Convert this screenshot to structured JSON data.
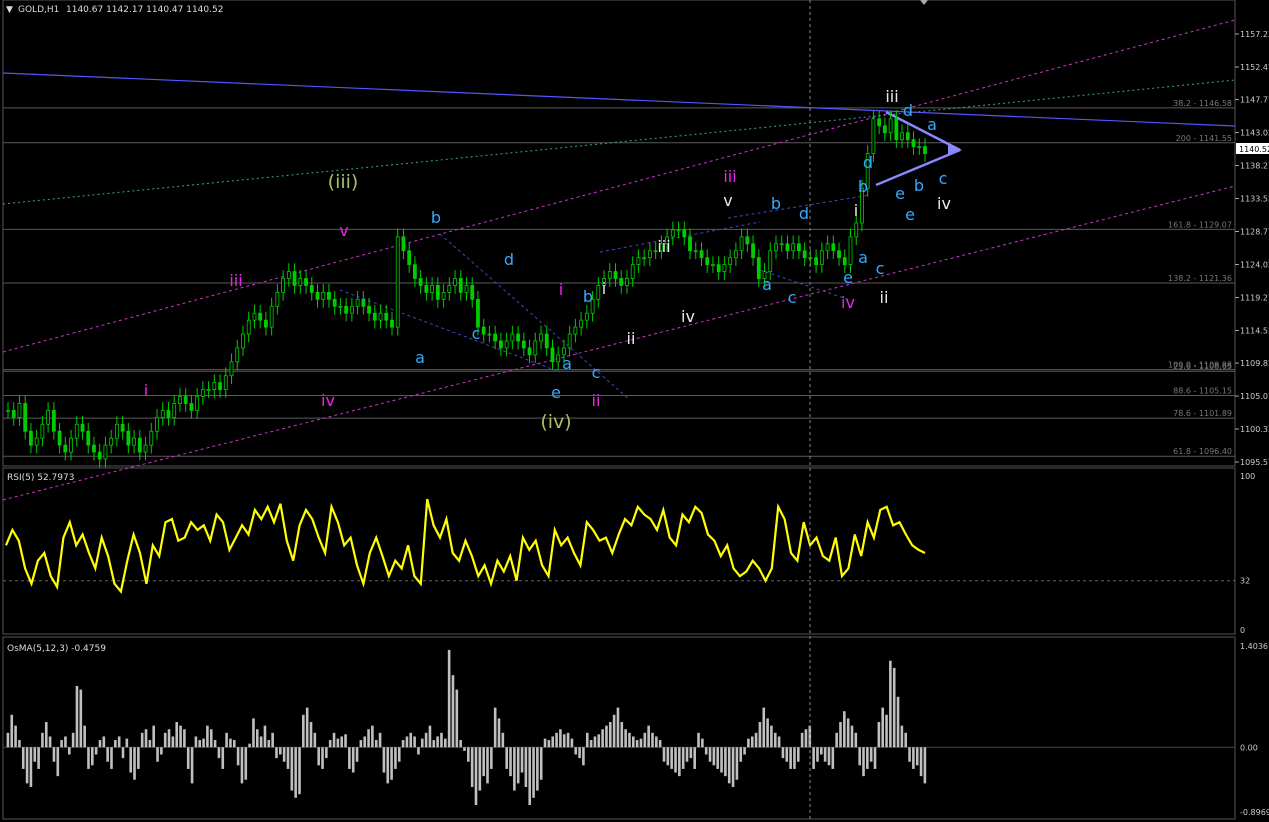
{
  "header": {
    "symbol": "GOLD,H1",
    "ohlc": "1140.67 1142.17 1140.47 1140.52"
  },
  "colors": {
    "background": "#000000",
    "candle": "#00cc00",
    "rsi": "#ffff00",
    "osma": "#c0c0c0",
    "channel": "#cc33cc",
    "trendline": "#5555ff",
    "fib": "#5a5a5a",
    "green_dotted": "#3aa88a"
  },
  "price_axis": {
    "ticks": [
      "1157.22",
      "1152.47",
      "1147.77",
      "1143.02",
      "1138.27",
      "1133.52",
      "1128.77",
      "1124.02",
      "1119.27",
      "1114.52",
      "1109.82",
      "1105.07",
      "1100.32",
      "1095.57"
    ],
    "current": "1140.52",
    "ylim": [
      1095,
      1160
    ]
  },
  "fib_levels": [
    {
      "label": "38.2 - 1146.58",
      "price": 1146.58
    },
    {
      "label": "200 - 1141.55",
      "price": 1141.55
    },
    {
      "label": "161.8 - 1129.07",
      "price": 1129.07
    },
    {
      "label": "138.2 - 1121.36",
      "price": 1121.36
    },
    {
      "label": "100.0 - 1108.88",
      "price": 1108.88
    },
    {
      "label": "23.6 - 1108.65",
      "price": 1108.65
    },
    {
      "label": "88.6 - 1105.15",
      "price": 1105.15
    },
    {
      "label": "78.6 - 1101.89",
      "price": 1101.89
    },
    {
      "label": "61.8 - 1096.40",
      "price": 1096.4
    }
  ],
  "wave_labels": {
    "magenta": [
      "i",
      "iv",
      "iii",
      "v",
      "i",
      "ii",
      "iii",
      "iv"
    ],
    "olive": [
      "(iii)",
      "(iv)"
    ],
    "white": [
      "i",
      "ii",
      "iii",
      "iv",
      "v",
      "i",
      "ii",
      "iii",
      "iv"
    ],
    "cyan": [
      "a",
      "b",
      "c",
      "d",
      "e",
      "a",
      "b",
      "c",
      "a",
      "b",
      "c",
      "d",
      "e",
      "a",
      "b",
      "c",
      "d",
      "e",
      "b",
      "a",
      "c",
      "d",
      "e"
    ]
  },
  "rsi": {
    "label": "RSI(5) 52.7973",
    "ticks": [
      "100",
      "32",
      "0"
    ],
    "level": 32
  },
  "osma": {
    "label": "OsMA(5,12,3) -0.4759",
    "ticks": [
      "1.4036",
      "0.00",
      "-0.8969"
    ],
    "range": [
      -0.8969,
      1.4036
    ]
  },
  "chart_data": [
    {
      "type": "candlestick",
      "title": "GOLD,H1",
      "ylim": [
        1095,
        1160
      ],
      "series": [
        {
          "name": "GOLD,H1",
          "values": [
            1103,
            1102,
            1104,
            1100,
            1098,
            1099,
            1101,
            1103,
            1100,
            1098,
            1097,
            1099,
            1101,
            1100,
            1098,
            1097,
            1096,
            1098,
            1099,
            1101,
            1100,
            1098,
            1099,
            1097,
            1098,
            1100,
            1102,
            1103,
            1102,
            1104,
            1105,
            1104,
            1103,
            1105,
            1106,
            1106,
            1107,
            1106,
            1108,
            1110,
            1112,
            1114,
            1116,
            1117,
            1116,
            1115,
            1118,
            1120,
            1122,
            1123,
            1121,
            1122,
            1121,
            1120,
            1119,
            1120,
            1119,
            1118,
            1118,
            1117,
            1118,
            1119,
            1118,
            1117,
            1116,
            1117,
            1116,
            1115,
            1128,
            1126,
            1124,
            1122,
            1121,
            1120,
            1121,
            1119,
            1120,
            1121,
            1122,
            1120,
            1121,
            1119,
            1115,
            1114,
            1114,
            1113,
            1112,
            1113,
            1114,
            1113,
            1112,
            1111,
            1113,
            1114,
            1112,
            1110,
            1111,
            1112,
            1114,
            1115,
            1116,
            1117,
            1119,
            1121,
            1122,
            1123,
            1122,
            1121,
            1122,
            1124,
            1125,
            1125,
            1126,
            1126,
            1127,
            1128,
            1129,
            1129,
            1128,
            1126,
            1126,
            1125,
            1124,
            1124,
            1123,
            1124,
            1125,
            1126,
            1128,
            1127,
            1125,
            1122,
            1123,
            1126,
            1127,
            1127,
            1126,
            1127,
            1126,
            1125,
            1125,
            1124,
            1126,
            1127,
            1126,
            1125,
            1124,
            1128,
            1130,
            1135,
            1140,
            1145,
            1144,
            1143,
            1145,
            1142,
            1143,
            1142,
            1141,
            1141,
            1140
          ]
        }
      ],
      "annotations": [
        "(iii)",
        "(iv)",
        "i",
        "ii",
        "iii",
        "iv",
        "v",
        "a",
        "b",
        "c",
        "d",
        "e"
      ]
    },
    {
      "type": "line",
      "title": "RSI(5) 52.7973",
      "ylim": [
        0,
        100
      ],
      "series": [
        {
          "name": "RSI(5)",
          "values": [
            55,
            65,
            58,
            40,
            30,
            45,
            50,
            35,
            28,
            60,
            70,
            55,
            62,
            50,
            40,
            60,
            48,
            30,
            25,
            45,
            62,
            50,
            30,
            55,
            48,
            70,
            72,
            58,
            60,
            70,
            65,
            68,
            58,
            75,
            70,
            52,
            60,
            68,
            62,
            78,
            72,
            80,
            70,
            82,
            58,
            45,
            68,
            78,
            72,
            60,
            50,
            80,
            70,
            55,
            60,
            42,
            30,
            50,
            60,
            48,
            35,
            45,
            40,
            55,
            35,
            30,
            85,
            68,
            60,
            72,
            50,
            45,
            58,
            48,
            35,
            42,
            30,
            45,
            38,
            48,
            32,
            60,
            52,
            58,
            42,
            35,
            65,
            55,
            60,
            50,
            42,
            70,
            65,
            58,
            60,
            50,
            62,
            72,
            68,
            80,
            75,
            72,
            65,
            78,
            60,
            55,
            75,
            70,
            80,
            76,
            62,
            58,
            48,
            55,
            40,
            35,
            38,
            45,
            40,
            32,
            40,
            80,
            72,
            50,
            45,
            70,
            55,
            60,
            48,
            45,
            60,
            35,
            40,
            62,
            48,
            70,
            60,
            78,
            80,
            68,
            70,
            62,
            55,
            52,
            50
          ]
        }
      ]
    },
    {
      "type": "bar",
      "title": "OsMA(5,12,3) -0.4759",
      "ylim": [
        -0.8969,
        1.4036
      ],
      "series": [
        {
          "name": "OsMA(5,12,3)",
          "values": [
            0.2,
            0.45,
            0.3,
            0.1,
            -0.3,
            -0.5,
            -0.55,
            -0.2,
            -0.3,
            0.2,
            0.35,
            0.15,
            -0.2,
            -0.4,
            0.1,
            0.15,
            -0.1,
            0.2,
            0.85,
            0.8,
            0.3,
            -0.3,
            -0.25,
            -0.1,
            0.1,
            0.15,
            -0.2,
            -0.3,
            0.1,
            0.15,
            -0.15,
            0.12,
            -0.35,
            -0.45,
            -0.3,
            0.2,
            0.25,
            0.1,
            0.3,
            -0.2,
            -0.1,
            0.2,
            0.25,
            0.15,
            0.35,
            0.3,
            0.25,
            -0.3,
            -0.5,
            0.15,
            0.1,
            0.12,
            0.3,
            0.25,
            0.1,
            -0.15,
            -0.3,
            0.2,
            0.12,
            0.1,
            -0.25,
            -0.5,
            -0.45,
            0.05,
            0.4,
            0.25,
            0.15,
            0.3,
            0.1,
            0.2,
            -0.15,
            -0.1,
            -0.2,
            -0.3,
            -0.6,
            -0.7,
            -0.65,
            0.45,
            0.55,
            0.35,
            0.2,
            -0.25,
            -0.3,
            -0.15,
            0.1,
            0.2,
            0.12,
            0.15,
            0.18,
            -0.3,
            -0.35,
            -0.2,
            0.1,
            0.15,
            0.25,
            0.3,
            0.1,
            0.2,
            -0.35,
            -0.5,
            -0.45,
            -0.3,
            -0.2,
            0.1,
            0.15,
            0.2,
            0.15,
            -0.1,
            0.12,
            0.2,
            0.3,
            0.1,
            0.15,
            0.2,
            0.12,
            1.35,
            1.0,
            0.8,
            0.1,
            -0.05,
            -0.2,
            -0.55,
            -0.8,
            -0.6,
            -0.4,
            -0.5,
            -0.3,
            0.55,
            0.4,
            0.2,
            -0.3,
            -0.4,
            -0.6,
            -0.5,
            -0.35,
            -0.55,
            -0.8,
            -0.7,
            -0.6,
            -0.45,
            0.12,
            0.1,
            0.15,
            0.2,
            0.25,
            0.18,
            0.2,
            0.12,
            -0.1,
            -0.15,
            -0.25,
            0.2,
            0.1,
            0.15,
            0.18,
            0.25,
            0.3,
            0.35,
            0.45,
            0.55,
            0.35,
            0.25,
            0.2,
            0.15,
            0.1,
            0.12,
            0.2,
            0.3,
            0.2,
            0.15,
            0.1,
            -0.2,
            -0.25,
            -0.3,
            -0.35,
            -0.4,
            -0.3,
            -0.2,
            -0.15,
            -0.3,
            0.2,
            0.12,
            -0.1,
            -0.2,
            -0.25,
            -0.3,
            -0.35,
            -0.4,
            -0.5,
            -0.55,
            -0.45,
            -0.2,
            -0.1,
            0.12,
            0.15,
            0.2,
            0.35,
            0.55,
            0.4,
            0.3,
            0.2,
            0.15,
            -0.15,
            -0.2,
            -0.3,
            -0.3,
            -0.2,
            0.2,
            0.25,
            0.3,
            -0.3,
            -0.2,
            -0.1,
            -0.2,
            -0.25,
            -0.3,
            0.2,
            0.35,
            0.5,
            0.4,
            0.3,
            0.2,
            -0.25,
            -0.4,
            -0.3,
            -0.2,
            -0.3,
            0.35,
            0.55,
            0.45,
            1.2,
            1.1,
            0.7,
            0.3,
            0.2,
            -0.2,
            -0.3,
            -0.25,
            -0.4,
            -0.5
          ]
        }
      ]
    }
  ]
}
